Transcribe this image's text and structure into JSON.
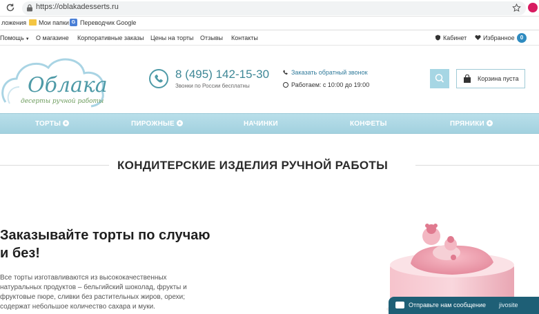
{
  "browser": {
    "url": "https://oblakadesserts.ru",
    "bookmarks": [
      {
        "label": "ложения"
      },
      {
        "label": "Мои папки"
      },
      {
        "label": "Переводчик Google"
      }
    ]
  },
  "topnav": {
    "items": [
      {
        "label": "Помощь"
      },
      {
        "label": "О магазине"
      },
      {
        "label": "Корпоративные заказы"
      },
      {
        "label": "Цены на торты"
      },
      {
        "label": "Отзывы"
      },
      {
        "label": "Контакты"
      }
    ],
    "cabinet": "Кабинет",
    "favorites": "Избранное",
    "favorites_count": "0"
  },
  "header": {
    "logo_title": "Облака",
    "logo_subtitle": "десерты ручной работы",
    "phone": "8 (495) 142-15-30",
    "phone_note": "Звонки по России бесплатны",
    "callback": "Заказать обратный звонок",
    "hours": "Работаем: с 10:00 до 19:00",
    "cart": "Корзина пуста"
  },
  "categories": [
    {
      "label": "ТОРТЫ",
      "expand": "+"
    },
    {
      "label": "ПИРОЖНЫЕ",
      "expand": "+"
    },
    {
      "label": "НАЧИНКИ",
      "expand": ""
    },
    {
      "label": "КОНФЕТЫ",
      "expand": ""
    },
    {
      "label": "ПРЯНИКИ",
      "expand": "+"
    }
  ],
  "main": {
    "section_title": "КОНДИТЕРСКИЕ ИЗДЕЛИЯ РУЧНОЙ РАБОТЫ",
    "hero_title": "Заказывайте торты по случаю и без!",
    "hero_text": "Все торты изготавливаются из высококачественных натуральных продуктов – бельгийский шоколад, фрукты и фруктовые пюре, сливки без растительных жиров, орехи; содержат небольшое количество сахара и муки."
  },
  "chat": {
    "label": "Отправьте нам сообщение",
    "brand": "jivosite"
  },
  "colors": {
    "accent": "#4e9aa7",
    "category_bar": "#a2d1df",
    "chat": "#1e5f76"
  }
}
